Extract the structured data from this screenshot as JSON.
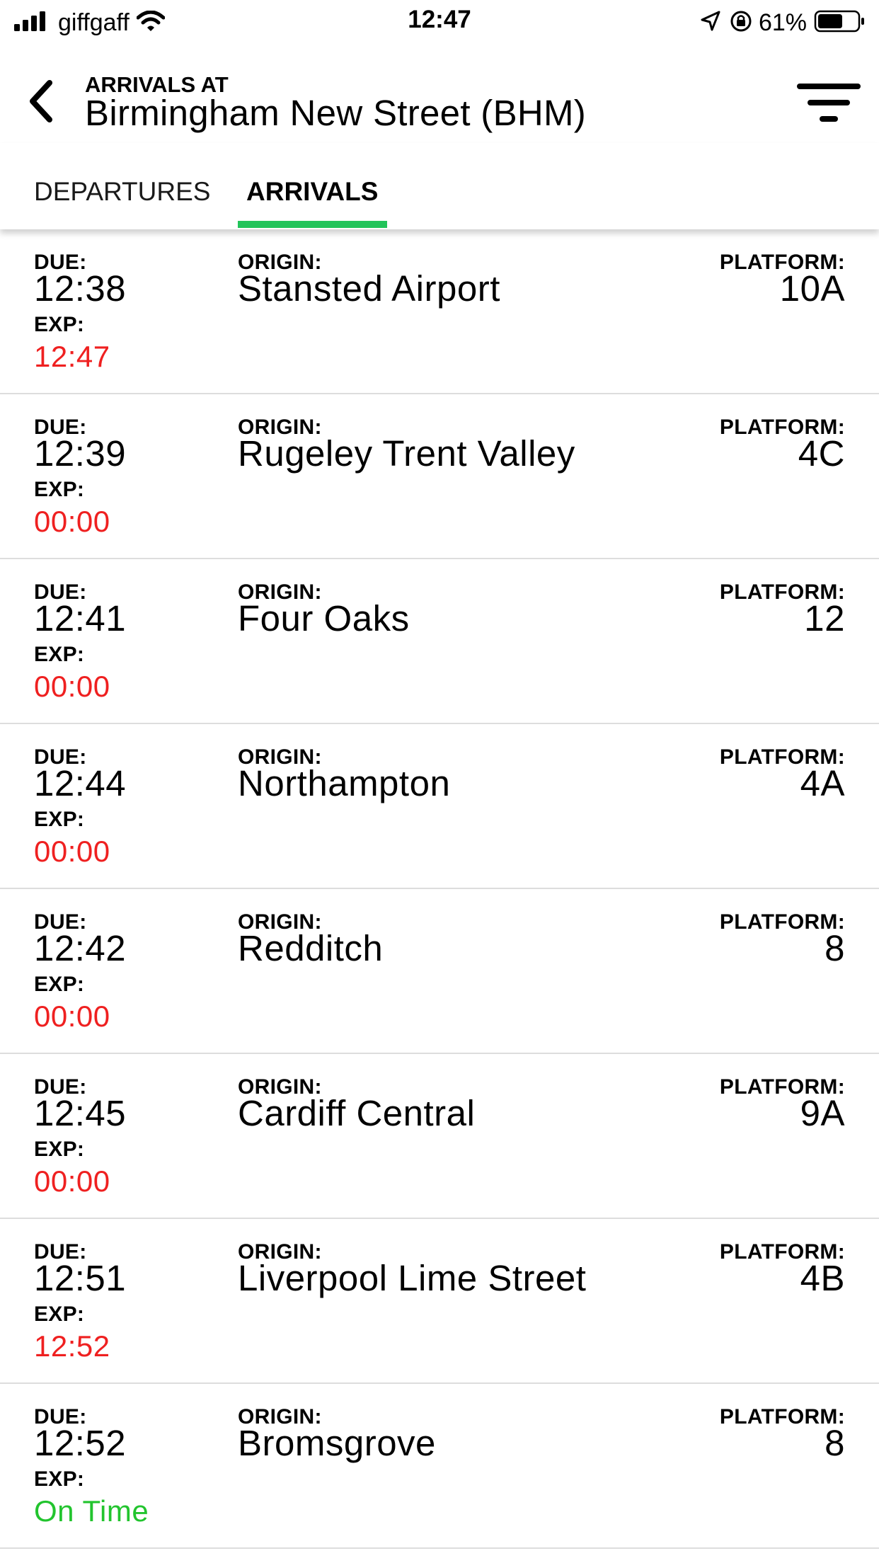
{
  "status_bar": {
    "carrier": "giffgaff",
    "time": "12:47",
    "battery_percent": "61%"
  },
  "header": {
    "subtitle": "ARRIVALS AT",
    "title": "Birmingham New Street (BHM)"
  },
  "tabs": [
    {
      "label": "DEPARTURES",
      "active": false
    },
    {
      "label": "ARRIVALS",
      "active": true
    }
  ],
  "labels": {
    "due": "DUE:",
    "exp": "EXP:",
    "origin": "ORIGIN:",
    "platform": "PLATFORM:"
  },
  "colors": {
    "accent": "#22c45a",
    "delayed": "#ef2020",
    "on_time": "#22c42e"
  },
  "arrivals": [
    {
      "due": "12:38",
      "expected": "12:47",
      "origin": "Stansted Airport",
      "platform": "10A",
      "status": "delayed"
    },
    {
      "due": "12:39",
      "expected": "00:00",
      "origin": "Rugeley Trent Valley",
      "platform": "4C",
      "status": "delayed"
    },
    {
      "due": "12:41",
      "expected": "00:00",
      "origin": "Four Oaks",
      "platform": "12",
      "status": "delayed"
    },
    {
      "due": "12:44",
      "expected": "00:00",
      "origin": "Northampton",
      "platform": "4A",
      "status": "delayed"
    },
    {
      "due": "12:42",
      "expected": "00:00",
      "origin": "Redditch",
      "platform": "8",
      "status": "delayed"
    },
    {
      "due": "12:45",
      "expected": "00:00",
      "origin": "Cardiff Central",
      "platform": "9A",
      "status": "delayed"
    },
    {
      "due": "12:51",
      "expected": "12:52",
      "origin": "Liverpool Lime Street",
      "platform": "4B",
      "status": "delayed"
    },
    {
      "due": "12:52",
      "expected": "On Time",
      "origin": "Bromsgrove",
      "platform": "8",
      "status": "on_time"
    }
  ]
}
